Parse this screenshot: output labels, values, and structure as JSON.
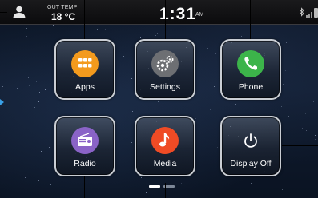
{
  "status_bar": {
    "temp_label": "OUT TEMP",
    "temp_value": "18 °C",
    "time": "1:31",
    "ampm": "AM"
  },
  "tiles": {
    "apps": {
      "label": "Apps",
      "color": "#f39a1d",
      "icon": "apps-grid-icon"
    },
    "settings": {
      "label": "Settings",
      "color": "#6d6f73",
      "icon": "gears-icon"
    },
    "phone": {
      "label": "Phone",
      "color": "#3cb44a",
      "icon": "phone-handset-icon"
    },
    "radio": {
      "label": "Radio",
      "color": "#8a63c7",
      "icon": "radio-icon"
    },
    "media": {
      "label": "Media",
      "color": "#ef4b25",
      "icon": "music-note-icon"
    },
    "display_off": {
      "label": "Display Off",
      "color": "#ffffff",
      "icon": "power-icon"
    }
  },
  "pagination": {
    "pages": 2,
    "current": 1
  }
}
